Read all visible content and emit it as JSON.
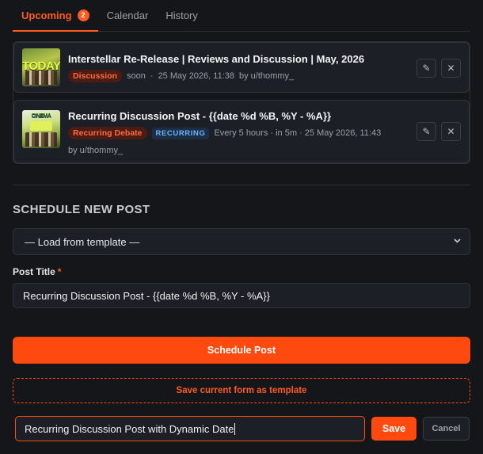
{
  "tabs": [
    {
      "label": "Upcoming",
      "count": "2",
      "active": true
    },
    {
      "label": "Calendar"
    },
    {
      "label": "History"
    }
  ],
  "posts": [
    {
      "title": "Interstellar Re-Release | Reviews and Discussion | May, 2026",
      "flair": "Discussion",
      "when": "soon",
      "date": "25 May 2026, 11:38",
      "author": "by u/thommy_",
      "thumb_text": "TODAY"
    },
    {
      "title": "Recurring Discussion Post - {{date %d %B, %Y - %A}}",
      "flair": "Recurring Debate",
      "tag": "RECURRING",
      "schedule": "Every 5 hours · in 5m · 25 May 2026, 11:43",
      "author": "by u/thommy_",
      "thumb_text": "CINEMA"
    }
  ],
  "actions": {
    "edit_glyph": "✎",
    "delete_glyph": "✕"
  },
  "schedule": {
    "section_title": "SCHEDULE NEW POST",
    "template_select": "— Load from template —",
    "title_label": "Post Title",
    "required_mark": "*",
    "title_value": "Recurring Discussion Post - {{date %d %B, %Y - %A}}",
    "submit_label": "Schedule Post",
    "save_template_label": "Save current form as template",
    "template_name_value": "Recurring Discussion Post with Dynamic Date",
    "save_label": "Save",
    "cancel_label": "Cancel"
  },
  "colors": {
    "accent": "#ff4a0f",
    "background": "#14161a",
    "card": "#1c1f25",
    "recurring": "#6fb3ff"
  }
}
